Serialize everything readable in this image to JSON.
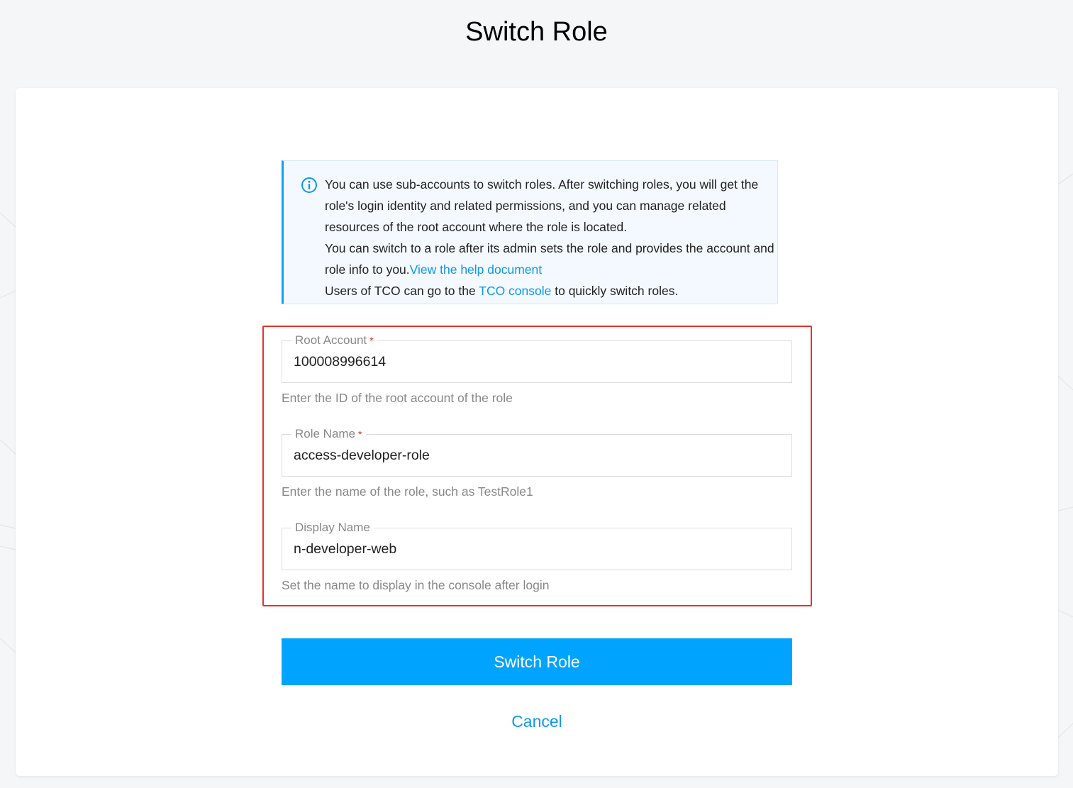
{
  "page": {
    "title": "Switch Role"
  },
  "notice": {
    "icon": "info-icon",
    "line1": "You can use sub-accounts to switch roles. After switching roles, you will get the role's login identity and related permissions, and you can manage related resources of the root account where the role is located.",
    "line2_prefix": "You can switch to a role after its admin sets the role and provides the account and role info to you.",
    "help_link": "View the help document",
    "line3_prefix": "Users of TCO can go to the ",
    "tco_link": "TCO console",
    "line3_suffix": " to quickly switch roles."
  },
  "form": {
    "root_account": {
      "label": "Root Account",
      "required_mark": "*",
      "value": "100008996614",
      "hint": "Enter the ID of the root account of the role"
    },
    "role_name": {
      "label": "Role Name",
      "required_mark": "*",
      "value": "access-developer-role",
      "hint": "Enter the name of the role, such as TestRole1"
    },
    "display_name": {
      "label": "Display Name",
      "value": "n-developer-web",
      "hint": "Set the name to display in the console after login"
    }
  },
  "actions": {
    "submit_label": "Switch Role",
    "cancel_label": "Cancel"
  },
  "colors": {
    "primary": "#00a4ff",
    "link": "#0d99e6",
    "highlight": "#e5332a",
    "required": "#e5332a"
  }
}
